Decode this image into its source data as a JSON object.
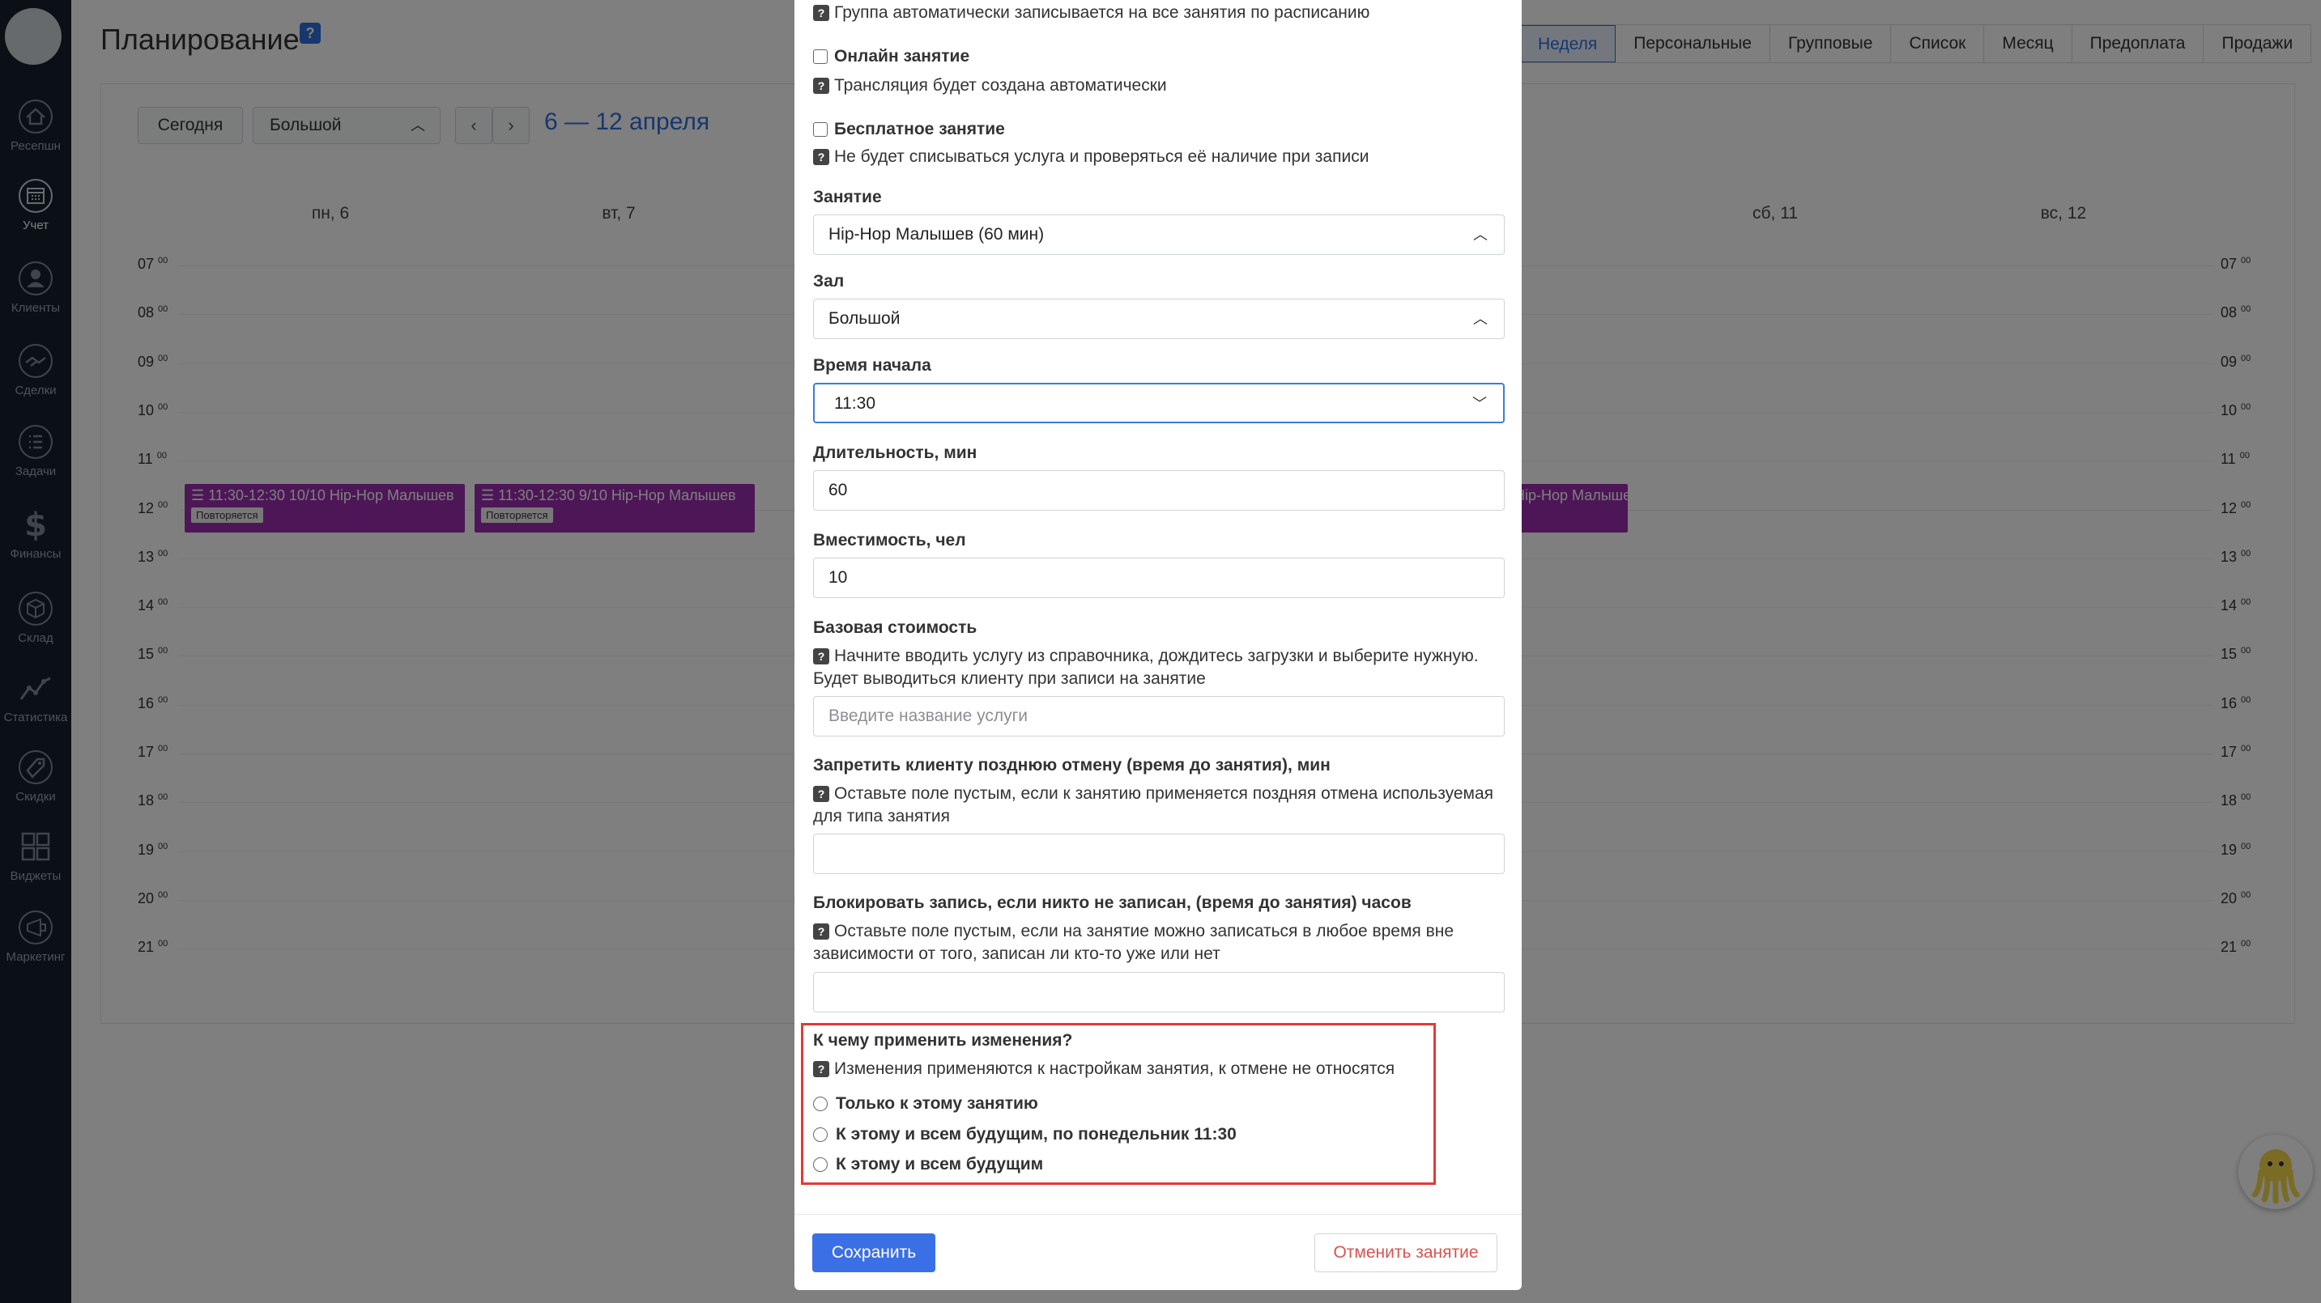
{
  "app": {
    "page_title": "Планирование",
    "help_glyph": "?"
  },
  "sidebar": {
    "items": [
      {
        "label": "Ресепшн",
        "icon": "home-icon"
      },
      {
        "label": "Учет",
        "icon": "calendar-icon"
      },
      {
        "label": "Клиенты",
        "icon": "client-icon"
      },
      {
        "label": "Сделки",
        "icon": "handshake-icon"
      },
      {
        "label": "Задачи",
        "icon": "tasks-icon"
      },
      {
        "label": "Финансы",
        "icon": "dollar-icon"
      },
      {
        "label": "Склад",
        "icon": "box-icon"
      },
      {
        "label": "Статистика",
        "icon": "chart-icon"
      },
      {
        "label": "Скидки",
        "icon": "discount-icon"
      },
      {
        "label": "Виджеты",
        "icon": "widgets-icon"
      },
      {
        "label": "Маркетинг",
        "icon": "marketing-icon"
      }
    ]
  },
  "tabs": [
    "Неделя",
    "Персональные",
    "Групповые",
    "Список",
    "Месяц",
    "Предоплата",
    "Продажи"
  ],
  "toolbar": {
    "today": "Сегодня",
    "hall": "Большой",
    "prev": "‹",
    "next": "›",
    "range": "6 — 12 апреля"
  },
  "calendar": {
    "days": [
      "пн, 6",
      "вт, 7",
      "сб, 11",
      "вс, 12"
    ],
    "hours": [
      "07",
      "08",
      "09",
      "10",
      "11",
      "12",
      "13",
      "14",
      "15",
      "16",
      "17",
      "18",
      "19",
      "20",
      "21"
    ],
    "hour_suffix": "00",
    "events": [
      {
        "text": "☰ 11:30-12:30 10/10 Hip-Hop Малышев",
        "tag": "Повторяется"
      },
      {
        "text": "☰ 11:30-12:30 9/10 Hip-Hop Малышев",
        "tag": "Повторяется"
      },
      {
        "text": "Hip-Hop Малышев",
        "tag": ""
      }
    ]
  },
  "modal": {
    "group_auto_note": "Группа автоматически записывается на все занятия по расписанию",
    "online_label": "Онлайн занятие",
    "online_note": "Трансляция будет создана автоматически",
    "free_label": "Бесплатное занятие",
    "free_note": "Не будет списываться услуга и проверяться её наличие при записи",
    "lesson_label": "Занятие",
    "lesson_value": "Hip-Hop Малышев (60 мин)",
    "hall_label": "Зал",
    "hall_value": "Большой",
    "start_label": "Время начала",
    "start_value": "11:30",
    "duration_label": "Длительность, мин",
    "duration_value": "60",
    "capacity_label": "Вместимость, чел",
    "capacity_value": "10",
    "price_label": "Базовая стоимость",
    "price_note": "Начните вводить услугу из справочника, дождитесь загрузки и выберите нужную. Будет выводиться клиенту при записи на занятие",
    "price_placeholder": "Введите название услуги",
    "late_cancel_label": "Запретить клиенту позднюю отмену (время до занятия), мин",
    "late_cancel_note": "Оставьте поле пустым, если к занятию применяется поздняя отмена используемая для типа занятия",
    "late_cancel_value": "",
    "block_label": "Блокировать запись, если никто не записан, (время до занятия) часов",
    "block_note": "Оставьте поле пустым, если на занятие можно записаться в любое время вне зависимости от того, записан ли кто-то уже или нет",
    "block_value": "",
    "apply_label": "К чему применить изменения?",
    "apply_note": "Изменения применяются к настройкам занятия, к отмене не относятся",
    "apply_options": [
      "Только к этому занятию",
      "К этому и всем будущим, по понедельник 11:30",
      "К этому и всем будущим"
    ],
    "save": "Сохранить",
    "cancel_lesson": "Отменить занятие"
  },
  "colors": {
    "sidebar_bg": "#15202b",
    "accent": "#2f6fdc",
    "event": "#9b2fae",
    "highlight": "#e53935",
    "danger": "#d9534f"
  }
}
